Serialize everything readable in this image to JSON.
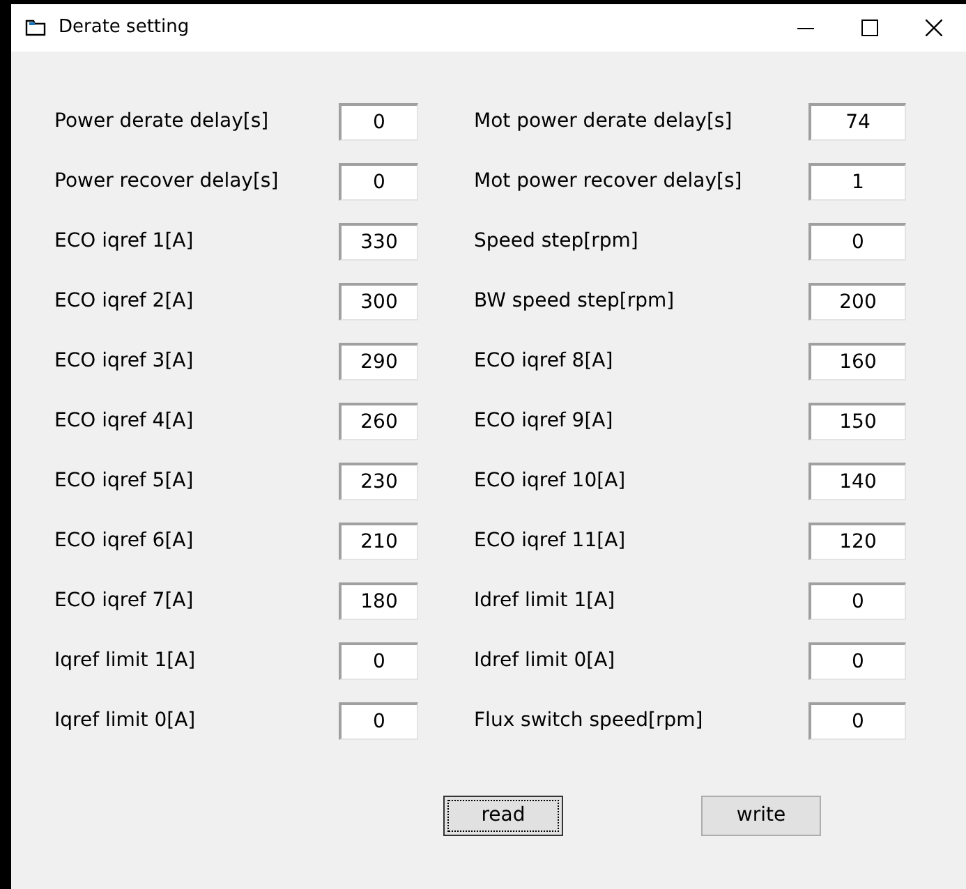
{
  "window": {
    "title": "Derate setting"
  },
  "rows": [
    {
      "left": {
        "label": "Power derate delay[s]",
        "value": "0"
      },
      "right": {
        "label": "Mot power derate delay[s]",
        "value": "74"
      }
    },
    {
      "left": {
        "label": "Power recover delay[s]",
        "value": "0"
      },
      "right": {
        "label": "Mot power recover delay[s]",
        "value": "1"
      }
    },
    {
      "left": {
        "label": "ECO iqref 1[A]",
        "value": "330"
      },
      "right": {
        "label": "Speed step[rpm]",
        "value": "0"
      }
    },
    {
      "left": {
        "label": "ECO iqref 2[A]",
        "value": "300"
      },
      "right": {
        "label": "BW speed step[rpm]",
        "value": "200"
      }
    },
    {
      "left": {
        "label": "ECO iqref 3[A]",
        "value": "290"
      },
      "right": {
        "label": "ECO iqref 8[A]",
        "value": "160"
      }
    },
    {
      "left": {
        "label": "ECO iqref 4[A]",
        "value": "260"
      },
      "right": {
        "label": "ECO iqref 9[A]",
        "value": "150"
      }
    },
    {
      "left": {
        "label": "ECO iqref 5[A]",
        "value": "230"
      },
      "right": {
        "label": "ECO iqref 10[A]",
        "value": "140"
      }
    },
    {
      "left": {
        "label": "ECO iqref 6[A]",
        "value": "210"
      },
      "right": {
        "label": "ECO iqref 11[A]",
        "value": "120"
      }
    },
    {
      "left": {
        "label": "ECO iqref 7[A]",
        "value": "180"
      },
      "right": {
        "label": "Idref limit 1[A]",
        "value": "0"
      }
    },
    {
      "left": {
        "label": "Iqref limit 1[A]",
        "value": "0"
      },
      "right": {
        "label": "Idref limit 0[A]",
        "value": "0"
      }
    },
    {
      "left": {
        "label": "Iqref limit 0[A]",
        "value": "0"
      },
      "right": {
        "label": "Flux switch speed[rpm]",
        "value": "0"
      }
    }
  ],
  "buttons": [
    {
      "label": "read",
      "focused": true
    },
    {
      "label": "write",
      "focused": false
    }
  ]
}
